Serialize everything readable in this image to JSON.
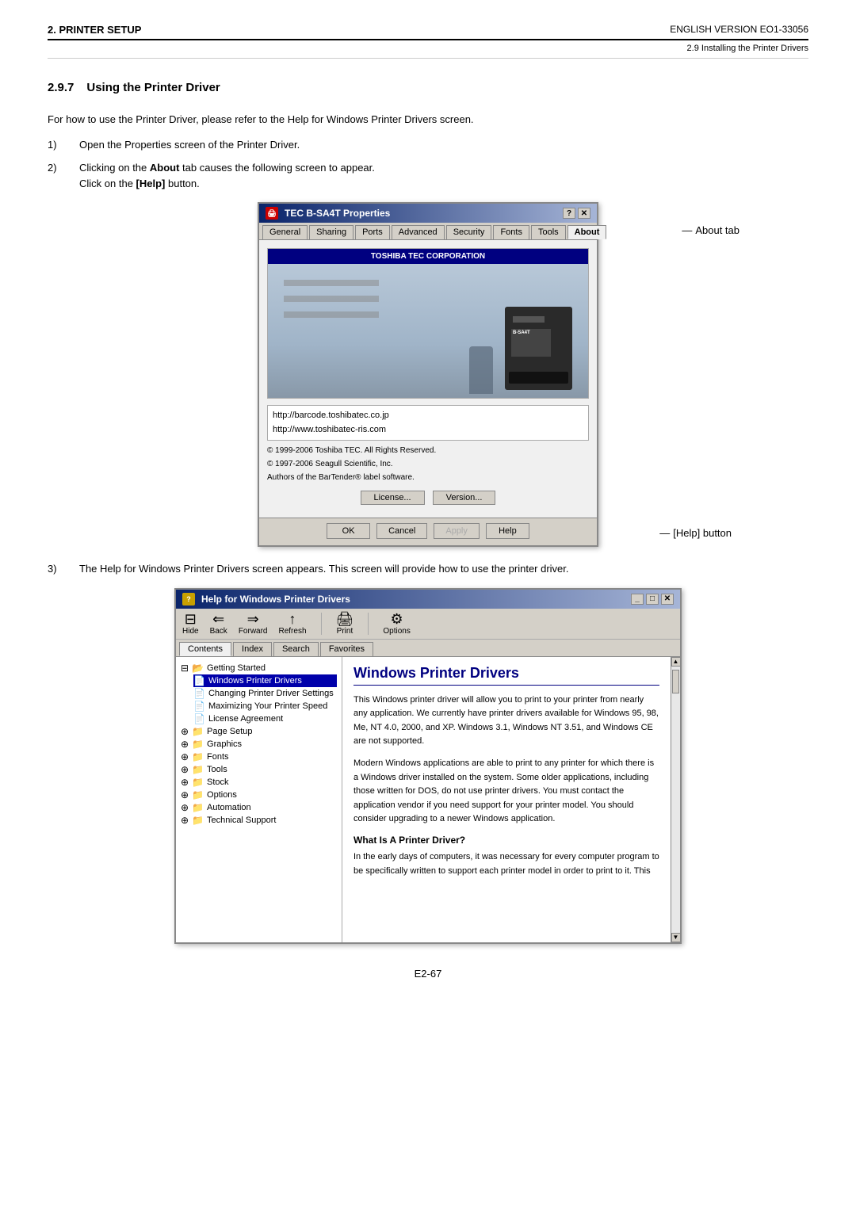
{
  "header": {
    "section": "2. PRINTER SETUP",
    "version": "ENGLISH VERSION EO1-33056",
    "subsection": "2.9 Installing the Printer Drivers"
  },
  "section": {
    "number": "2.9.7",
    "title": "Using the Printer Driver",
    "intro": "For how to use the Printer Driver, please refer to the Help for Windows Printer Drivers screen."
  },
  "steps": [
    {
      "num": "1)",
      "text": "Open the Properties screen of the Printer Driver."
    },
    {
      "num": "2)",
      "text_pre": "Clicking on the ",
      "bold": "About",
      "text_post": " tab causes the following screen to appear.",
      "text2": "Click on the ",
      "bold2": "[Help]",
      "text2_post": " button."
    },
    {
      "num": "3)",
      "text": "The Help for Windows Printer Drivers screen appears.  This screen will provide how to use the printer driver."
    }
  ],
  "properties_dialog": {
    "title": "TEC B-SA4T Properties",
    "tabs": [
      "General",
      "Sharing",
      "Ports",
      "Advanced",
      "Security",
      "Fonts",
      "Tools",
      "About"
    ],
    "active_tab": "About",
    "about_tab_annotation": "About tab",
    "image_title": "TOSHIBA TEC CORPORATION",
    "links": [
      "http://barcode.toshibatec.co.jp",
      "http://www.toshibatec-ris.com"
    ],
    "copyright1": "© 1999-2006 Toshiba TEC.  All Rights Reserved.",
    "copyright2": "© 1997-2006 Seagull Scientific, Inc.",
    "copyright3": "Authors of the BarTender® label software.",
    "license_btn": "License...",
    "version_btn": "Version...",
    "buttons": {
      "ok": "OK",
      "cancel": "Cancel",
      "apply": "Apply",
      "help": "Help"
    },
    "help_btn_annotation": "[Help] button"
  },
  "help_dialog": {
    "title": "Help for Windows Printer Drivers",
    "toolbar": [
      {
        "icon": "⊟",
        "label": "Hide"
      },
      {
        "icon": "←",
        "label": "Back"
      },
      {
        "icon": "→",
        "label": "Forward"
      },
      {
        "icon": "↻",
        "label": "Refresh"
      },
      {
        "icon": "🖨",
        "label": "Print"
      },
      {
        "icon": "⚙",
        "label": "Options"
      }
    ],
    "tabs": [
      "Contents",
      "Index",
      "Search",
      "Favorites"
    ],
    "active_tab": "Contents",
    "tree": [
      {
        "type": "root",
        "label": "Getting Started",
        "icon": "📂",
        "expanded": true
      },
      {
        "type": "child",
        "label": "Windows Printer Drivers",
        "selected": true
      },
      {
        "type": "child",
        "label": "Changing Printer Driver Settings"
      },
      {
        "type": "child",
        "label": "Maximizing Your Printer Speed"
      },
      {
        "type": "child",
        "label": "License Agreement"
      },
      {
        "type": "node",
        "label": "Page Setup",
        "icon": "⊕"
      },
      {
        "type": "node",
        "label": "Graphics",
        "icon": "⊕"
      },
      {
        "type": "node",
        "label": "Fonts",
        "icon": "⊕"
      },
      {
        "type": "node",
        "label": "Tools",
        "icon": "⊕"
      },
      {
        "type": "node",
        "label": "Stock",
        "icon": "⊕"
      },
      {
        "type": "node",
        "label": "Options",
        "icon": "⊕"
      },
      {
        "type": "node",
        "label": "Automation",
        "icon": "⊕"
      },
      {
        "type": "node",
        "label": "Technical Support",
        "icon": "⊕"
      }
    ],
    "content_title": "Windows Printer Drivers",
    "content_paras": [
      "This Windows printer driver will allow you to print to your printer from nearly any application.  We currently have printer drivers available for Windows 95, 98, Me, NT 4.0, 2000, and XP.  Windows 3.1, Windows NT 3.51, and Windows CE are not supported.",
      "Modern Windows applications are able to print to any printer for which there is a Windows driver installed on the system. Some older applications, including those written for DOS, do not use printer drivers.  You must contact the application vendor if you need support for your printer model.  You should consider upgrading to a newer Windows application."
    ],
    "content_sub": "What Is A Printer Driver?",
    "content_para3": "In the early days of computers, it was necessary for every computer program to be specifically written to support each printer model in order to print to it.  This"
  },
  "footer": {
    "page": "E2-67"
  }
}
